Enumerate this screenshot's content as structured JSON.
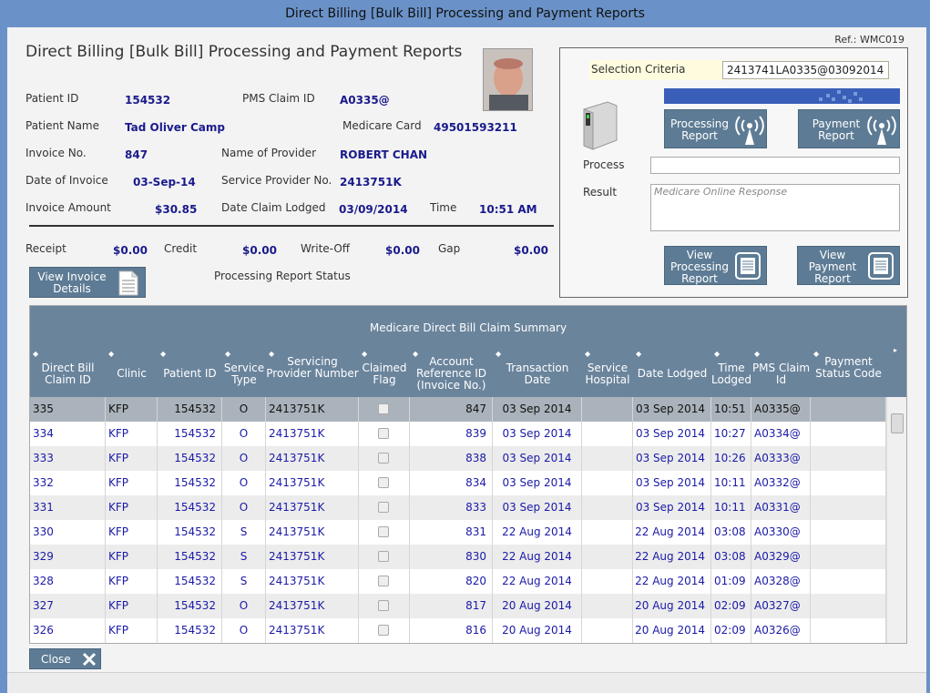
{
  "window": {
    "title": "Direct Billing [Bulk Bill] Processing and Payment Reports"
  },
  "ref": "Ref.: WMC019",
  "heading": "Direct Billing [Bulk Bill] Processing and Payment Reports",
  "patient": {
    "patient_id_label": "Patient ID",
    "patient_id": "154532",
    "pms_claim_id_label": "PMS Claim ID",
    "pms_claim_id": "A0335@",
    "patient_name_label": "Patient Name",
    "patient_name": "Tad Oliver Camp",
    "medicare_card_label": "Medicare Card",
    "medicare_card": "49501593211",
    "invoice_no_label": "Invoice No.",
    "invoice_no": "847",
    "provider_name_label": "Name of Provider",
    "provider_name": "ROBERT CHAN",
    "date_of_invoice_label": "Date of Invoice",
    "date_of_invoice": "03-Sep-14",
    "service_provider_no_label": "Service Provider No.",
    "service_provider_no": "2413751K",
    "invoice_amount_label": "Invoice Amount",
    "invoice_amount": "$30.85",
    "date_claim_lodged_label": "Date Claim Lodged",
    "date_claim_lodged": "03/09/2014",
    "time_label": "Time",
    "time": "10:51 AM"
  },
  "totals": {
    "receipt_label": "Receipt",
    "receipt": "$0.00",
    "credit_label": "Credit",
    "credit": "$0.00",
    "writeoff_label": "Write-Off",
    "writeoff": "$0.00",
    "gap_label": "Gap",
    "gap": "$0.00"
  },
  "view_invoice_label": "View Invoice Details",
  "processing_status_label": "Processing Report Status",
  "panel": {
    "selection_criteria_label": "Selection Criteria",
    "selection_criteria_value": "2413741LA0335@03092014",
    "processing_report_label": "Processing Report",
    "payment_report_label": "Payment Report",
    "process_label": "Process",
    "result_label": "Result",
    "result_placeholder": "Medicare Online Response",
    "view_processing_label": "View Processing Report",
    "view_payment_label": "View Payment Report"
  },
  "grid": {
    "title": "Medicare Direct Bill Claim Summary",
    "columns": [
      "Direct Bill Claim ID",
      "Clinic",
      "Patient ID",
      "Service Type",
      "Servicing Provider Number",
      "Claimed Flag",
      "Account Reference ID (Invoice No.)",
      "Transaction Date",
      "Service Hospital",
      "Date Lodged",
      "Time Lodged",
      "PMS Claim Id",
      "Payment Status Code"
    ],
    "rows": [
      {
        "id": "335",
        "clinic": "KFP",
        "patient": "154532",
        "type": "O",
        "provider": "2413751K",
        "invoice": "847",
        "tdate": "03 Sep 2014",
        "hospital": "",
        "lodged": "03 Sep 2014",
        "time": "10:51",
        "pms": "A0335@",
        "status": ""
      },
      {
        "id": "334",
        "clinic": "KFP",
        "patient": "154532",
        "type": "O",
        "provider": "2413751K",
        "invoice": "839",
        "tdate": "03 Sep 2014",
        "hospital": "",
        "lodged": "03 Sep 2014",
        "time": "10:27",
        "pms": "A0334@",
        "status": ""
      },
      {
        "id": "333",
        "clinic": "KFP",
        "patient": "154532",
        "type": "O",
        "provider": "2413751K",
        "invoice": "838",
        "tdate": "03 Sep 2014",
        "hospital": "",
        "lodged": "03 Sep 2014",
        "time": "10:26",
        "pms": "A0333@",
        "status": ""
      },
      {
        "id": "332",
        "clinic": "KFP",
        "patient": "154532",
        "type": "O",
        "provider": "2413751K",
        "invoice": "834",
        "tdate": "03 Sep 2014",
        "hospital": "",
        "lodged": "03 Sep 2014",
        "time": "10:11",
        "pms": "A0332@",
        "status": ""
      },
      {
        "id": "331",
        "clinic": "KFP",
        "patient": "154532",
        "type": "O",
        "provider": "2413751K",
        "invoice": "833",
        "tdate": "03 Sep 2014",
        "hospital": "",
        "lodged": "03 Sep 2014",
        "time": "10:11",
        "pms": "A0331@",
        "status": ""
      },
      {
        "id": "330",
        "clinic": "KFP",
        "patient": "154532",
        "type": "S",
        "provider": "2413751K",
        "invoice": "831",
        "tdate": "22 Aug 2014",
        "hospital": "",
        "lodged": "22 Aug 2014",
        "time": "03:08",
        "pms": "A0330@",
        "status": ""
      },
      {
        "id": "329",
        "clinic": "KFP",
        "patient": "154532",
        "type": "S",
        "provider": "2413751K",
        "invoice": "830",
        "tdate": "22 Aug 2014",
        "hospital": "",
        "lodged": "22 Aug 2014",
        "time": "03:08",
        "pms": "A0329@",
        "status": ""
      },
      {
        "id": "328",
        "clinic": "KFP",
        "patient": "154532",
        "type": "S",
        "provider": "2413751K",
        "invoice": "820",
        "tdate": "22 Aug 2014",
        "hospital": "",
        "lodged": "22 Aug 2014",
        "time": "01:09",
        "pms": "A0328@",
        "status": ""
      },
      {
        "id": "327",
        "clinic": "KFP",
        "patient": "154532",
        "type": "O",
        "provider": "2413751K",
        "invoice": "817",
        "tdate": "20 Aug 2014",
        "hospital": "",
        "lodged": "20 Aug 2014",
        "time": "02:09",
        "pms": "A0327@",
        "status": ""
      },
      {
        "id": "326",
        "clinic": "KFP",
        "patient": "154532",
        "type": "O",
        "provider": "2413751K",
        "invoice": "816",
        "tdate": "20 Aug 2014",
        "hospital": "",
        "lodged": "20 Aug 2014",
        "time": "02:09",
        "pms": "A0326@",
        "status": ""
      }
    ]
  },
  "close_label": "Close"
}
